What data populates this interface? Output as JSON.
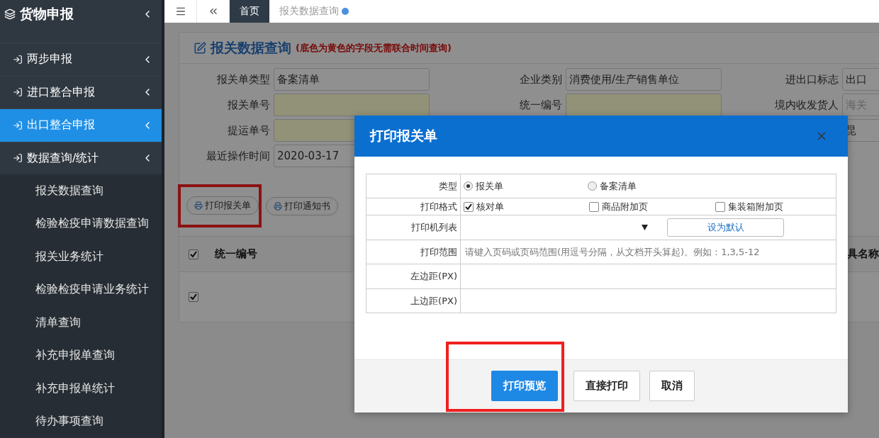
{
  "sidebar": {
    "title": "货物申报",
    "items": [
      {
        "label": "两步申报",
        "selected": false
      },
      {
        "label": "进口整合申报",
        "selected": false
      },
      {
        "label": "出口整合申报",
        "selected": true
      },
      {
        "label": "数据查询/统计",
        "selected": false,
        "children": [
          {
            "label": "报关数据查询",
            "selected": false
          },
          {
            "label": "检验检疫申请数据查询",
            "selected": false
          },
          {
            "label": "报关业务统计",
            "selected": false
          },
          {
            "label": "检验检疫申请业务统计",
            "selected": false
          },
          {
            "label": "清单查询",
            "selected": false
          },
          {
            "label": "补充申报单查询",
            "selected": false
          },
          {
            "label": "补充申报单统计",
            "selected": false
          },
          {
            "label": "待办事项查询",
            "selected": false
          }
        ]
      }
    ]
  },
  "tabs": [
    {
      "label": "首页",
      "selected": true,
      "closable": false
    },
    {
      "label": "报关数据查询",
      "selected": false,
      "closable": true
    }
  ],
  "panel": {
    "title": "报关数据查询",
    "note": "(底色为黄色的字段无需联合时间查询)",
    "rows": [
      [
        {
          "label": "报关单类型",
          "value": "备案清单",
          "highlighted": false
        },
        {
          "label": "企业类别",
          "value": "消费使用/生产销售单位",
          "highlighted": false
        },
        {
          "label": "进出口标志",
          "value": "出口",
          "highlighted": false
        }
      ],
      [
        {
          "label": "报关单号",
          "highlighted": true
        },
        {
          "label": "统一编号",
          "highlighted": true
        },
        {
          "label": "境内收发货人",
          "placeholder": "海关",
          "highlighted": false
        }
      ],
      [
        {
          "label": "提运单号",
          "highlighted": true
        },
        null,
        {
          "value": "昆",
          "highlighted": false
        }
      ],
      [
        {
          "label": "最近操作时间",
          "value": "2020-03-17",
          "highlighted": false
        }
      ]
    ],
    "buttons": [
      "打印报关单",
      "打印通知书"
    ],
    "table": {
      "columns": [
        "统一编号",
        "具名称"
      ],
      "header_checked": true,
      "rows": [
        {
          "checked": true
        }
      ]
    }
  },
  "dialog": {
    "title": "打印报关单",
    "type_label": "类型",
    "type_options": [
      {
        "label": "报关单",
        "selected": true
      },
      {
        "label": "备案清单",
        "selected": false
      }
    ],
    "format_label": "打印格式",
    "format_options": [
      {
        "label": "核对单",
        "checked": true
      },
      {
        "label": "商品附加页",
        "checked": false
      },
      {
        "label": "集装箱附加页",
        "checked": false
      }
    ],
    "printer_label": "打印机列表",
    "default_button": "设为默认",
    "range_label": "打印范围",
    "range_placeholder": "请键入页码或页码范围(用逗号分隔，从文档开头算起)。例如：1,3,5-12",
    "left_margin_label": "左边距(PX)",
    "top_margin_label": "上边距(PX)",
    "buttons": [
      {
        "label": "打印预览",
        "kind": "primary"
      },
      {
        "label": "直接打印",
        "kind": "default"
      },
      {
        "label": "取消",
        "kind": "default"
      }
    ]
  }
}
